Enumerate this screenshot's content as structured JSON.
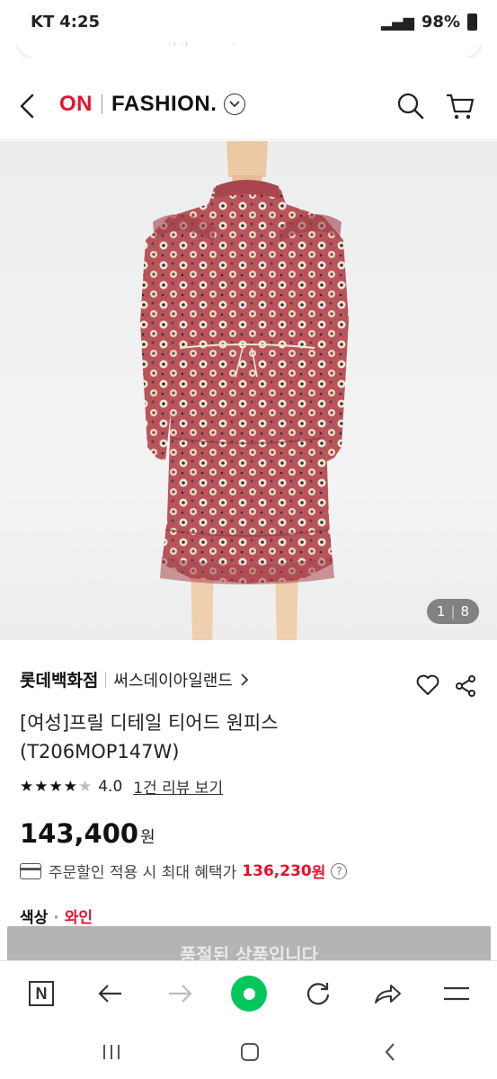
{
  "status_bar": {
    "carrier": "KT",
    "time": "4:25",
    "battery": "98%"
  },
  "url_bar": {
    "url": "www.lotteon.com/p/product/LE1206..."
  },
  "header": {
    "logo_on": "ON",
    "logo_fashion": "FASHION",
    "logo_dot": "."
  },
  "gallery": {
    "current": "1",
    "total": "8"
  },
  "product": {
    "store": "롯데백화점",
    "brand": "써스데이아일랜드",
    "title": "[여성]프릴 디테일 티어드 원피스 (T206MOP147W)",
    "rating_value": "4.0",
    "rating_stars": 4,
    "review_link": "1건 리뷰 보기",
    "price": "143,400",
    "price_unit": "원",
    "benefit_label": "주문할인 적용 시 최대 혜택가",
    "benefit_price": "136,230",
    "benefit_unit": "원",
    "option_label": "색상",
    "option_value": "와인",
    "soldout_button": "품절된 상품입니다"
  },
  "colors": {
    "accent": "#e8112d",
    "soldout": "#b4b4b4",
    "naver_green": "#03c75a"
  }
}
